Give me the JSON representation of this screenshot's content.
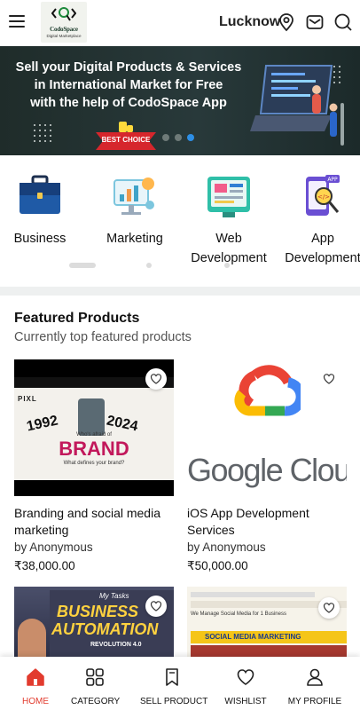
{
  "header": {
    "logo_name": "CodoSpace",
    "logo_sub": "Digital Marketplace",
    "city": "Lucknow"
  },
  "banner": {
    "lines": [
      "Sell your Digital Products & Services",
      "in International Market for Free",
      "with the help of CodoSpace App"
    ],
    "badge": "BEST CHOICE",
    "active_slide": 3,
    "slide_count": 3
  },
  "categories": [
    {
      "label": "Business",
      "icon": "briefcase-icon"
    },
    {
      "label": "Marketing",
      "icon": "marketing-analytics-icon"
    },
    {
      "label_1": "Web",
      "label_2": "Development",
      "icon": "web-development-icon"
    },
    {
      "label_1": "App",
      "label_2": "Development",
      "icon": "app-development-icon"
    }
  ],
  "featured": {
    "title": "Featured Products",
    "subtitle": "Currently top featured products",
    "products": [
      {
        "title_1": "Branding and social media",
        "title_2": "marketing",
        "by_prefix": "by",
        "author": "Anonymous",
        "price": "₹38,000.00",
        "thumb": {
          "brand": "PIXL",
          "big": "BRAND",
          "y1": "1992",
          "y2": "2024",
          "q": "Who's afraid of",
          "small": "What defines your brand?"
        }
      },
      {
        "title_1": "iOS App Development",
        "title_2": "Services",
        "by_prefix": "by",
        "author": "Anonymous",
        "price": "₹50,000.00",
        "thumb": {
          "text": "Google Cloud"
        }
      },
      {
        "thumb": {
          "kicker": "My Tasks",
          "line1": "BUSINESS",
          "line2": "AUTOMATION",
          "line3": "REVOLUTION 4.0"
        }
      },
      {
        "thumb": {
          "line1": "We Manage Social Media for 1 Business",
          "line2": "SOCIAL MEDIA MARKETING"
        }
      }
    ]
  },
  "nav": [
    {
      "label": "HOME",
      "icon": "home-icon",
      "active": true
    },
    {
      "label": "CATEGORY",
      "icon": "category-grid-icon"
    },
    {
      "label": "SELL PRODUCT",
      "icon": "bookmark-icon"
    },
    {
      "label": "WISHLIST",
      "icon": "heart-icon"
    },
    {
      "label": "MY PROFILE",
      "icon": "profile-icon"
    }
  ],
  "colors": {
    "accent": "#e23b2e",
    "slide_active": "#2d8fe6",
    "banner_bg": "#24302f"
  }
}
